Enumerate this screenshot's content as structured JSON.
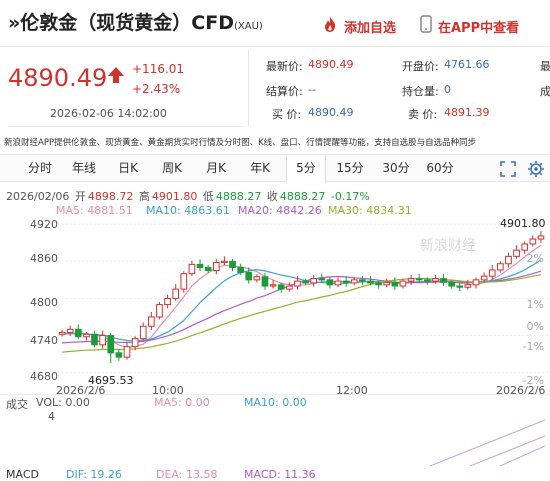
{
  "header": {
    "title": "»伦敦金（现货黄金）CFD",
    "code": "(XAU)",
    "add_watchlist": "添加自选",
    "view_in_app": "在APP中查看"
  },
  "quote": {
    "price": "4890.49",
    "change": "+116.01",
    "change_pct": "+2.43%",
    "datetime": "2026-02-06 14:02:00"
  },
  "stats": {
    "latest_label": "最新价:",
    "latest_value": "4890.49",
    "prev_close_label": "开盘价:",
    "prev_close_value": "4761.66",
    "settle_label": "结算价:",
    "settle_value": "--",
    "hold_label": "持仓量:",
    "hold_value": "0",
    "bid_label": "买 价:",
    "bid_value": "4890.49",
    "ask_label": "卖 价:",
    "ask_value": "4891.39",
    "cut_r1": "最",
    "cut_r2": "成"
  },
  "info_line": "新浪财经APP提供伦敦金、现货黄金、黄金期货实时行情及分时图、K线、盘口、行情提醒等功能，支持自选股与自选品种同步",
  "tabs": [
    "分时",
    "年线",
    "日K",
    "周K",
    "月K",
    "年K",
    "5分",
    "15分",
    "30分",
    "60分"
  ],
  "active_tab": "5分",
  "ohlc": {
    "date": "2026/02/06",
    "open_label": "开",
    "open": "4898.72",
    "high_label": "高",
    "high": "4901.80",
    "low_label": "低",
    "low": "4888.27",
    "close_label": "收",
    "close": "4888.27",
    "pct": "-0.17%"
  },
  "ma": {
    "ma5": "MA5: 4881.51",
    "ma10": "MA10: 4863.61",
    "ma20": "MA20: 4842.26",
    "ma30": "MA30: 4834.31"
  },
  "axis": {
    "y": [
      "4920",
      "4860",
      "4800",
      "4740",
      "4680"
    ],
    "pct": [
      "2%",
      "1%",
      "0%",
      "-1%",
      "-2%"
    ],
    "x": [
      "2026/2/6",
      "10:00",
      "12:00",
      "2026/2/6"
    ]
  },
  "chart_data": {
    "type": "candlestick",
    "ylim": [
      4660,
      4930
    ],
    "high_label": "4901.80",
    "low_label": "4695.53",
    "watermark": "新浪财经"
  },
  "volume": {
    "label": "成交",
    "vol": "VOL: 0.00",
    "ma5": "MA5: 0.00",
    "ma10": "MA10: 0.00",
    "axis_max": "4"
  },
  "macd": {
    "label": "MACD",
    "dif": "DIF: 19.26",
    "dea": "DEA: 13.58",
    "macd": "MACD: 11.36"
  },
  "colors": {
    "up": "#d2322d",
    "down": "#1c9b39",
    "ma5": "#e58fb0",
    "ma10": "#39a3d6",
    "ma20": "#b35bc8",
    "ma30": "#8fb52b"
  }
}
